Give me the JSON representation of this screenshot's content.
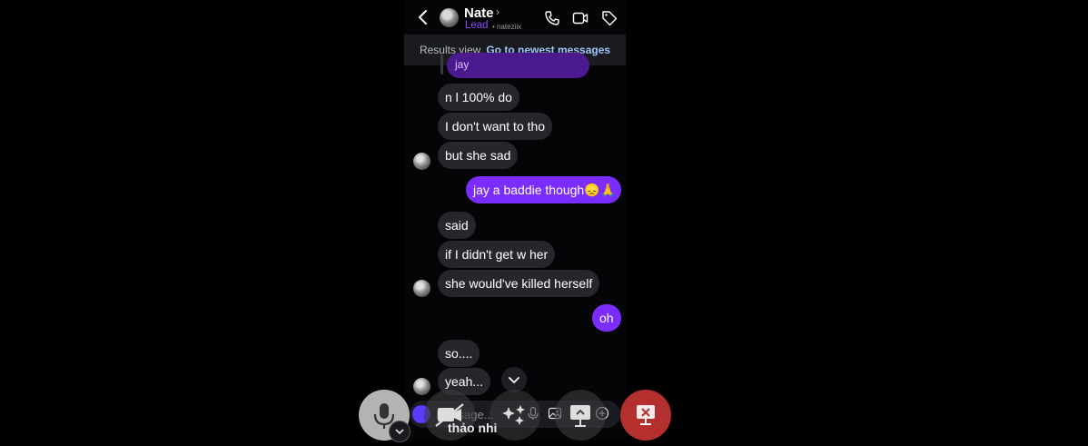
{
  "header": {
    "name": "Nate",
    "role": "Lead",
    "handle": "nateziix",
    "back_icon": "chevron-left-icon",
    "icons": [
      "phone-icon",
      "video-icon",
      "tag-icon"
    ]
  },
  "banner": {
    "prefix": "Results view.",
    "link": "Go to newest messages"
  },
  "reply_preview": "jay",
  "messages": [
    {
      "text": "n l 100% do",
      "dir": "in"
    },
    {
      "text": "I don't want to tho",
      "dir": "in"
    },
    {
      "text": "but she sad",
      "dir": "in"
    },
    {
      "text": "jay a baddie though😞🙏",
      "dir": "out"
    },
    {
      "text": "said",
      "dir": "in"
    },
    {
      "text": "if I didn't get w her",
      "dir": "in"
    },
    {
      "text": "she would've killed herself",
      "dir": "in"
    },
    {
      "text": "oh",
      "dir": "out"
    },
    {
      "text": "so....",
      "dir": "in"
    },
    {
      "text": "yeah...",
      "dir": "in"
    }
  ],
  "composer": {
    "placeholder": "Message..."
  },
  "call_overlay": {
    "caller_text": "thảo nhi",
    "buttons": [
      "mic-icon",
      "camera-off-icon",
      "effects-icon",
      "screen-share-icon",
      "end-share-icon"
    ],
    "colors": {
      "dark": "#2a2a2e",
      "end": "#b3302f"
    }
  },
  "colors": {
    "accent": "#7b2cff",
    "incoming": "#26272c",
    "lead": "#8a4bff"
  }
}
